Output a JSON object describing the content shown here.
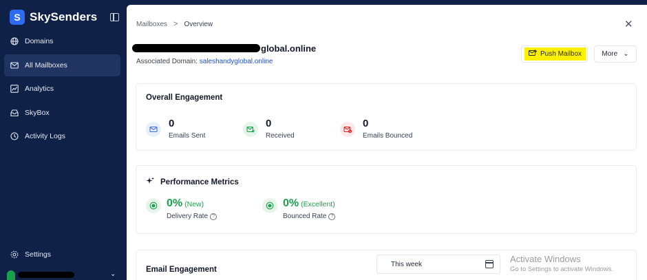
{
  "brand": {
    "name": "SkySenders"
  },
  "sidebar": {
    "items": [
      {
        "label": "Domains",
        "icon": "globe-icon"
      },
      {
        "label": "All Mailboxes",
        "icon": "mail-icon",
        "active": true
      },
      {
        "label": "Analytics",
        "icon": "chart-icon"
      },
      {
        "label": "SkyBox",
        "icon": "inbox-icon"
      },
      {
        "label": "Activity Logs",
        "icon": "history-icon"
      }
    ],
    "settings_label": "Settings"
  },
  "breadcrumb": {
    "parent": "Mailboxes",
    "separator": ">",
    "current": "Overview"
  },
  "mailbox": {
    "email_suffix": "global.online",
    "associated_label": "Associated Domain:",
    "associated_domain": "saleshandyglobal.online"
  },
  "actions": {
    "push_label": "Push Mailbox",
    "more_label": "More"
  },
  "overall": {
    "title": "Overall Engagement",
    "stats": [
      {
        "value": "0",
        "label": "Emails Sent",
        "color": "#3b6fe0",
        "bg": "#e8effc"
      },
      {
        "value": "0",
        "label": "Received",
        "color": "#16a34a",
        "bg": "#e6f4ea"
      },
      {
        "value": "0",
        "label": "Emails Bounced",
        "color": "#dc2626",
        "bg": "#fde8e8"
      }
    ]
  },
  "performance": {
    "title": "Performance Metrics",
    "metrics": [
      {
        "value": "0%",
        "tag": "(New)",
        "label": "Delivery Rate"
      },
      {
        "value": "0%",
        "tag": "(Excellent)",
        "label": "Bounced Rate"
      }
    ]
  },
  "engagement": {
    "title": "Email Engagement",
    "range": "This week"
  },
  "watermark": {
    "title": "Activate Windows",
    "subtitle": "Go to Settings to activate Windows."
  },
  "colors": {
    "sidebar": "#0f2147",
    "accent": "#2f6bf0",
    "success": "#16a34a",
    "highlight": "#ffef00"
  }
}
